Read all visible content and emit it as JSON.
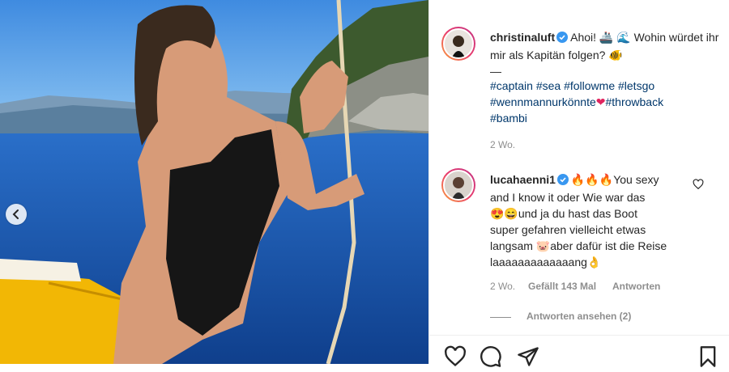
{
  "post": {
    "username": "christinaluft",
    "caption_text": "Ahoi! 🚢 🌊 Wohin würdet ihr mir als Kapitän folgen? 🐠",
    "caption_dash": "—",
    "hashtags": [
      "#captain",
      "#sea",
      "#followme",
      "#letsgo",
      "#wennmannurkönnte",
      "#throwback",
      "#bambi"
    ],
    "heart_emoji": "❤",
    "time": "2 Wo."
  },
  "comment": {
    "username": "lucahaenni1",
    "line1": "🔥🔥🔥You sexy",
    "line2": "and I know it oder Wie war das",
    "line3": "😍😄und ja du hast das Boot",
    "line4": "super gefahren vielleicht etwas",
    "line5": "langsam 🐷aber dafür ist die Reise",
    "line6": "laaaaaaaaaaaaang👌",
    "time": "2 Wo.",
    "likes": "Gefällt 143 Mal",
    "reply": "Antworten",
    "view_replies": "Antworten ansehen (2)"
  },
  "icons": {
    "verified": "verified-badge-icon",
    "like": "heart-icon",
    "comment": "comment-icon",
    "share": "share-icon",
    "save": "bookmark-icon",
    "prev": "chevron-left-icon"
  },
  "colors": {
    "link": "#00376b",
    "verified": "#3897f0",
    "meta": "#8e8e8e"
  }
}
